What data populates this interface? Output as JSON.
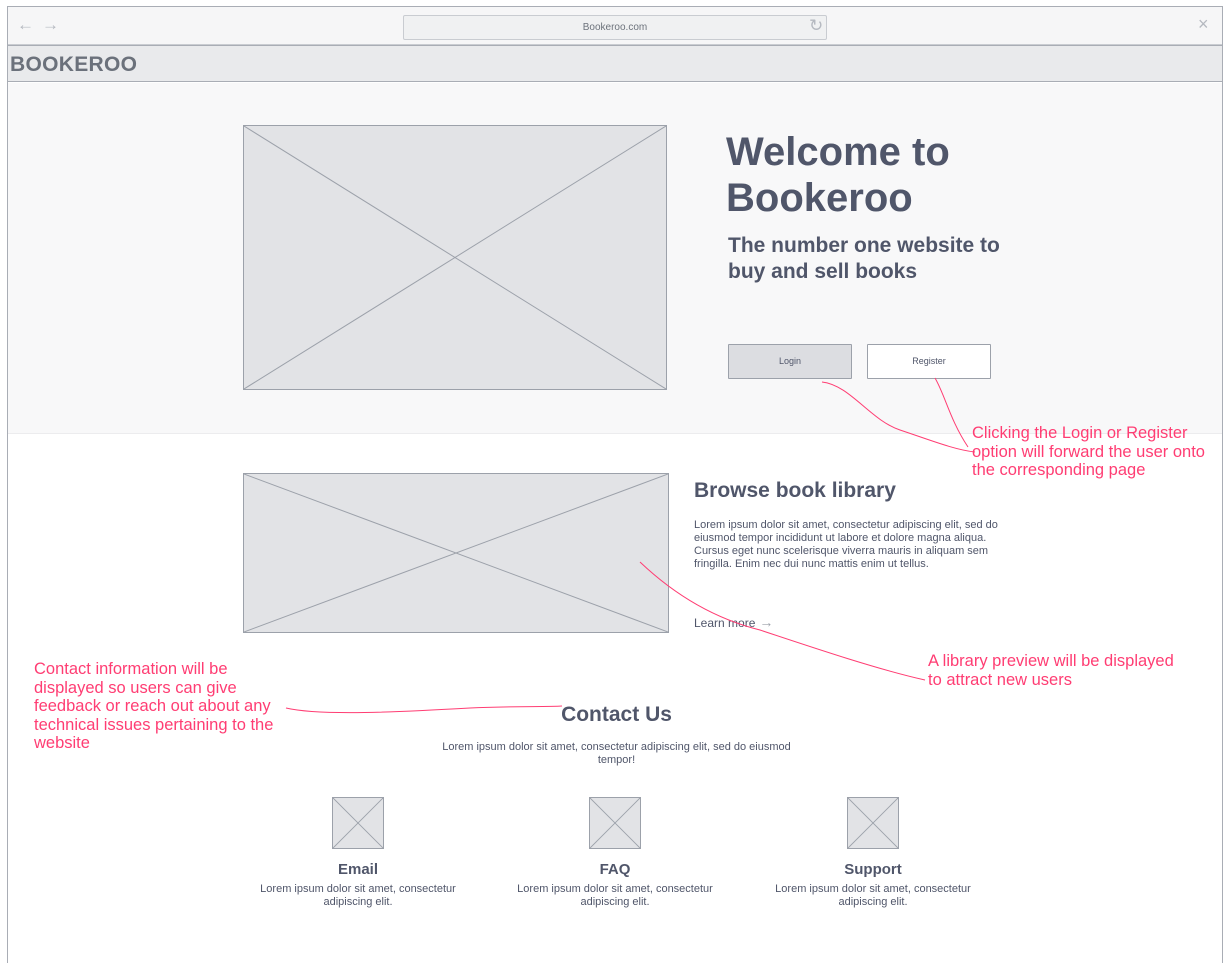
{
  "browser": {
    "url": "Bookeroo.com",
    "back_icon": "arrow-left",
    "forward_icon": "arrow-right",
    "reload_icon": "reload",
    "close_icon": "close"
  },
  "header": {
    "brand": "BOOKEROO"
  },
  "hero": {
    "title_line1": "Welcome to",
    "title_line2": "Bookeroo",
    "subtitle": "The number one website to buy and sell books",
    "login_label": "Login",
    "register_label": "Register"
  },
  "browse": {
    "title": "Browse book library",
    "text": "Lorem ipsum dolor sit amet, consectetur adipiscing elit, sed do eiusmod tempor incididunt ut labore et dolore magna aliqua. Cursus eget nunc scelerisque viverra mauris in aliquam sem fringilla. Enim nec dui nunc mattis enim ut tellus.",
    "learn_more": "Learn more",
    "learn_more_arrow": "→"
  },
  "contact": {
    "title": "Contact Us",
    "text": "Lorem ipsum dolor sit amet, consectetur adipiscing elit, sed do eiusmod tempor!",
    "cards": [
      {
        "title": "Email",
        "text": "Lorem ipsum dolor sit amet, consectetur adipiscing elit."
      },
      {
        "title": "FAQ",
        "text": "Lorem ipsum dolor sit amet, consectetur adipiscing elit."
      },
      {
        "title": "Support",
        "text": "Lorem ipsum dolor sit amet, consectetur adipiscing elit."
      }
    ]
  },
  "annotations": {
    "login_register": "Clicking the Login or Register option will forward the user onto the corresponding page",
    "library_preview": "A library preview will be displayed to attract new users",
    "contact_info": "Contact information will be displayed so users can give feedback or reach out about any technical issues pertaining to the website"
  },
  "colors": {
    "annotation": "#ff3d73",
    "text": "#50566a",
    "placeholder": "#e2e3e6",
    "border": "#9ca1aa"
  }
}
